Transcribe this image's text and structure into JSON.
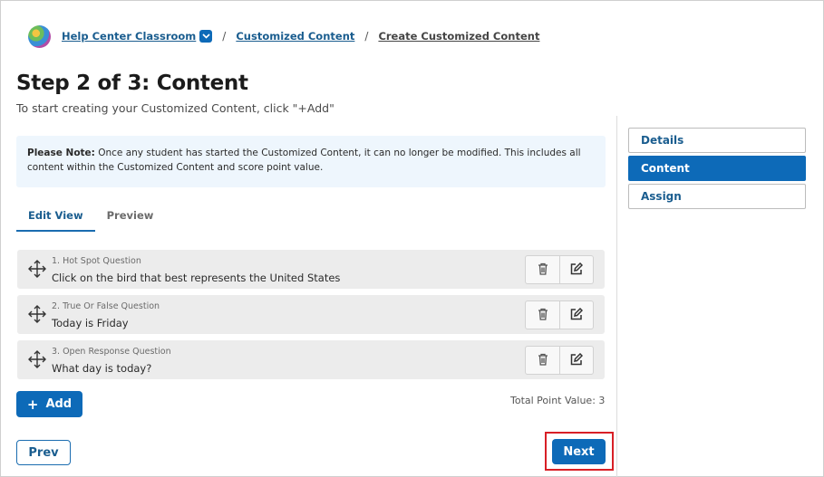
{
  "colors": {
    "accent": "#0d6ab8",
    "link": "#1a5d8f",
    "note_bg": "#eef6fd",
    "highlight": "#d81f26",
    "row_bg": "#ececec"
  },
  "breadcrumb": {
    "class_name": "Help Center Classroom",
    "separator": "/",
    "section": "Customized Content",
    "current": "Create Customized Content"
  },
  "header": {
    "title": "Step 2 of 3: Content",
    "subtitle": "To start creating your Customized Content, click \"+Add\""
  },
  "note": {
    "label": "Please Note:",
    "text": " Once any student has started the Customized Content, it can no longer be modified. This includes all content within the Customized Content and score point value."
  },
  "tabs": [
    {
      "label": "Edit View",
      "active": true
    },
    {
      "label": "Preview",
      "active": false
    }
  ],
  "questions": [
    {
      "number_type": "1. Hot Spot Question",
      "text": "Click on the bird that best represents the United States"
    },
    {
      "number_type": "2. True Or False Question",
      "text": "Today is Friday"
    },
    {
      "number_type": "3. Open Response Question",
      "text": "What day is today?"
    }
  ],
  "icons": {
    "move": "move-arrows-icon",
    "delete": "trash-icon",
    "edit": "edit-icon",
    "dropdown": "chevron-down-icon"
  },
  "actions": {
    "add_plus": "+",
    "add_label": "Add",
    "total_point_value": "Total Point Value: 3",
    "prev_label": "Prev",
    "next_label": "Next"
  },
  "stepper": [
    {
      "label": "Details",
      "active": false
    },
    {
      "label": "Content",
      "active": true
    },
    {
      "label": "Assign",
      "active": false
    }
  ]
}
